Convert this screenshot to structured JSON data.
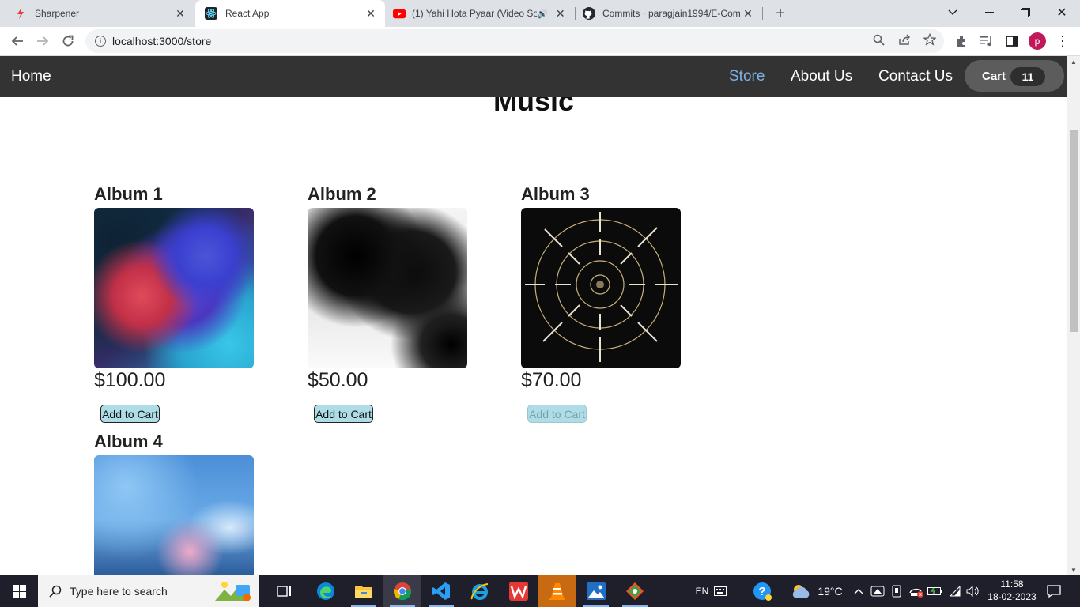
{
  "browser": {
    "tabs": [
      {
        "title": "Sharpener",
        "icon": "sharpener-icon",
        "active": false
      },
      {
        "title": "React App",
        "icon": "react-icon",
        "active": true
      },
      {
        "title": "(1) Yahi Hota Pyaar (Video So",
        "icon": "youtube-icon",
        "active": false
      },
      {
        "title": "Commits · paragjain1994/E-Comm",
        "icon": "github-icon",
        "active": false
      }
    ],
    "url": "localhost:3000/store"
  },
  "app": {
    "nav": {
      "home": "Home",
      "links": [
        "Store",
        "About Us",
        "Contact Us"
      ],
      "active_link": "Store",
      "cart_label": "Cart",
      "cart_count": "11"
    },
    "heading": "Music",
    "albums": [
      {
        "title": "Album 1",
        "price": "$100.00",
        "button": "Add to Cart"
      },
      {
        "title": "Album 2",
        "price": "$50.00",
        "button": "Add to Cart"
      },
      {
        "title": "Album 3",
        "price": "$70.00",
        "button": "Add to Cart"
      },
      {
        "title": "Album 4",
        "price": "",
        "button": ""
      }
    ]
  },
  "taskbar": {
    "search_placeholder": "Type here to search",
    "lang": "EN",
    "weather": "19°C",
    "time": "11:58",
    "date": "18-02-2023"
  },
  "colors": {
    "nav_bg": "#333333",
    "nav_active": "#7eb4e2",
    "button_bg": "#aedde7"
  }
}
